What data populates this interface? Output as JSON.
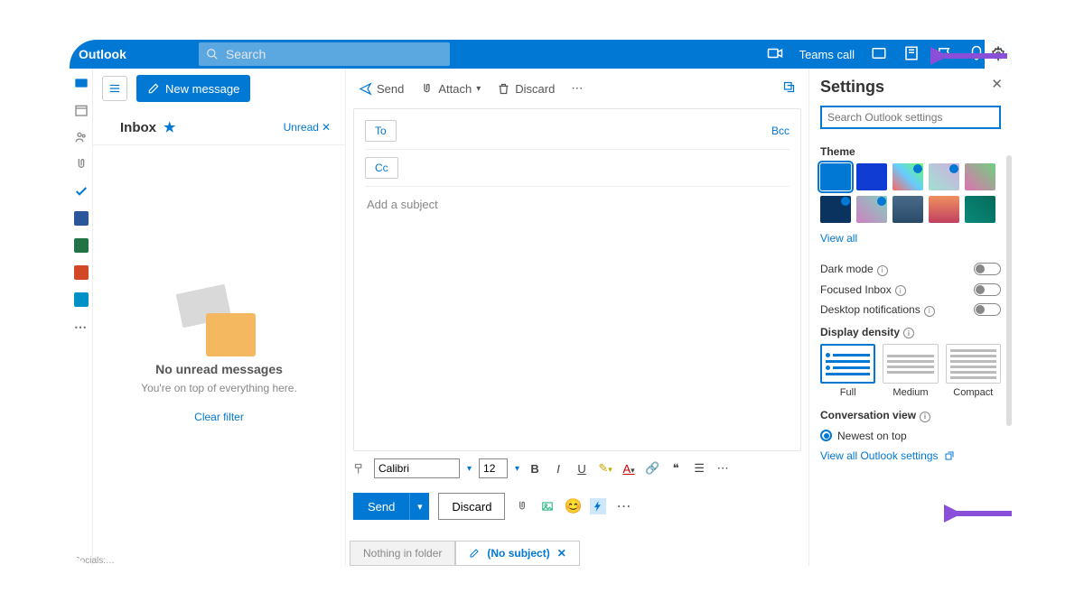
{
  "topbar": {
    "brand": "Outlook",
    "search_placeholder": "Search",
    "teams_call": "Teams call"
  },
  "rail": {
    "apps": [
      {
        "name": "mail",
        "color": "#0078d4"
      },
      {
        "name": "calendar",
        "color": "#0078d4"
      },
      {
        "name": "people",
        "color": "#888"
      },
      {
        "name": "files",
        "color": "#888"
      },
      {
        "name": "todo",
        "color": "#0078d4"
      },
      {
        "name": "word",
        "color": "#2b579a"
      },
      {
        "name": "excel",
        "color": "#217346"
      },
      {
        "name": "powerpoint",
        "color": "#d24726"
      },
      {
        "name": "yammer",
        "color": "#0078d4"
      }
    ]
  },
  "folders": {
    "new_message": "New message",
    "inbox_title": "Inbox",
    "unread_chip": "Unread",
    "empty_title": "No unread messages",
    "empty_subtitle": "You're on top of everything here.",
    "clear_filter": "Clear filter"
  },
  "compose": {
    "send": "Send",
    "attach": "Attach",
    "discard": "Discard",
    "to": "To",
    "cc": "Cc",
    "bcc": "Bcc",
    "subject_placeholder": "Add a subject",
    "font_name": "Calibri",
    "font_size": "12",
    "send_btn": "Send",
    "discard_btn": "Discard"
  },
  "tabs": {
    "nothing": "Nothing in folder",
    "nosubject": "(No subject)"
  },
  "settings": {
    "title": "Settings",
    "search_placeholder": "Search Outlook settings",
    "theme_label": "Theme",
    "view_all": "View all",
    "dark_mode": "Dark mode",
    "focused_inbox": "Focused Inbox",
    "desktop_notifications": "Desktop notifications",
    "display_density": "Display density",
    "density_full": "Full",
    "density_medium": "Medium",
    "density_compact": "Compact",
    "conversation_view": "Conversation view",
    "newest_on_top": "Newest on top",
    "view_all_settings": "View all Outlook settings"
  },
  "footer": {
    "socials": "Socials:…"
  }
}
